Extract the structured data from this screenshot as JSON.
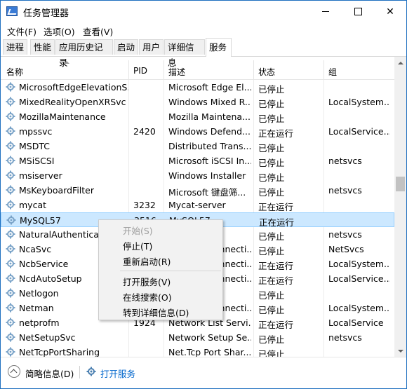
{
  "window": {
    "title": "任务管理器"
  },
  "menu": {
    "items": [
      "文件(F)",
      "选项(O)",
      "查看(V)"
    ]
  },
  "tabs": [
    "进程",
    "性能",
    "应用历史记录",
    "启动",
    "用户",
    "详细信息",
    "服务"
  ],
  "active_tab": "服务",
  "columns": {
    "name": "名称",
    "pid": "PID",
    "desc": "描述",
    "status": "状态",
    "group": "组"
  },
  "rows": [
    {
      "name": "MicrosoftEdgeElevationS...",
      "pid": "",
      "desc": "Microsoft Edge El...",
      "status": "已停止",
      "group": ""
    },
    {
      "name": "MixedRealityOpenXRSvc",
      "pid": "",
      "desc": "Windows Mixed R...",
      "status": "已停止",
      "group": "LocalSystem..."
    },
    {
      "name": "MozillaMaintenance",
      "pid": "",
      "desc": "Mozilla Maintena...",
      "status": "已停止",
      "group": ""
    },
    {
      "name": "mpssvc",
      "pid": "2420",
      "desc": "Windows Defend...",
      "status": "正在运行",
      "group": "LocalService..."
    },
    {
      "name": "MSDTC",
      "pid": "",
      "desc": "Distributed Trans...",
      "status": "已停止",
      "group": ""
    },
    {
      "name": "MSiSCSI",
      "pid": "",
      "desc": "Microsoft iSCSI In...",
      "status": "已停止",
      "group": "netsvcs"
    },
    {
      "name": "msiserver",
      "pid": "",
      "desc": "Windows Installer",
      "status": "已停止",
      "group": ""
    },
    {
      "name": "MsKeyboardFilter",
      "pid": "",
      "desc": "Microsoft 键盘筛...",
      "status": "已停止",
      "group": "netsvcs"
    },
    {
      "name": "mycat",
      "pid": "3232",
      "desc": "Mycat-server",
      "status": "正在运行",
      "group": ""
    },
    {
      "name": "MySQL57",
      "pid": "3516",
      "desc": "MySQL57",
      "status": "正在运行",
      "group": ""
    },
    {
      "name": "NaturalAuthentication",
      "pid": "",
      "desc": "",
      "status": "已停止",
      "group": "netsvcs"
    },
    {
      "name": "NcaSvc",
      "pid": "",
      "desc": "Network Connecti...",
      "status": "已停止",
      "group": "NetSvcs"
    },
    {
      "name": "NcbService",
      "pid": "",
      "desc": "Network Connecti...",
      "status": "正在运行",
      "group": "LocalSystem..."
    },
    {
      "name": "NcdAutoSetup",
      "pid": "",
      "desc": "Network Connecti...",
      "status": "正在运行",
      "group": "LocalService..."
    },
    {
      "name": "Netlogon",
      "pid": "",
      "desc": "",
      "status": "已停止",
      "group": ""
    },
    {
      "name": "Netman",
      "pid": "",
      "desc": "Network Connecti...",
      "status": "已停止",
      "group": "LocalSystem..."
    },
    {
      "name": "netprofm",
      "pid": "1924",
      "desc": "Network List Servi...",
      "status": "正在运行",
      "group": "LocalService"
    },
    {
      "name": "NetSetupSvc",
      "pid": "",
      "desc": "Network Setup Se...",
      "status": "已停止",
      "group": "netsvcs"
    },
    {
      "name": "NetTcpPortSharing",
      "pid": "",
      "desc": "Net.Tcp Port Shar...",
      "status": "已停止",
      "group": ""
    }
  ],
  "context_menu": {
    "items": [
      {
        "label": "开始(S)",
        "disabled": true
      },
      {
        "label": "停止(T)",
        "disabled": false
      },
      {
        "label": "重新启动(R)",
        "disabled": false
      },
      {
        "label": "打开服务(V)",
        "disabled": false
      },
      {
        "label": "在线搜索(O)",
        "disabled": false
      },
      {
        "label": "转到详细信息(D)",
        "disabled": false
      }
    ]
  },
  "footer": {
    "fewer_details": "简略信息(D)",
    "open_services": "打开服务"
  },
  "colors": {
    "selection": "#cce8ff",
    "link": "#0066cc",
    "border": "#1e6fbf"
  }
}
